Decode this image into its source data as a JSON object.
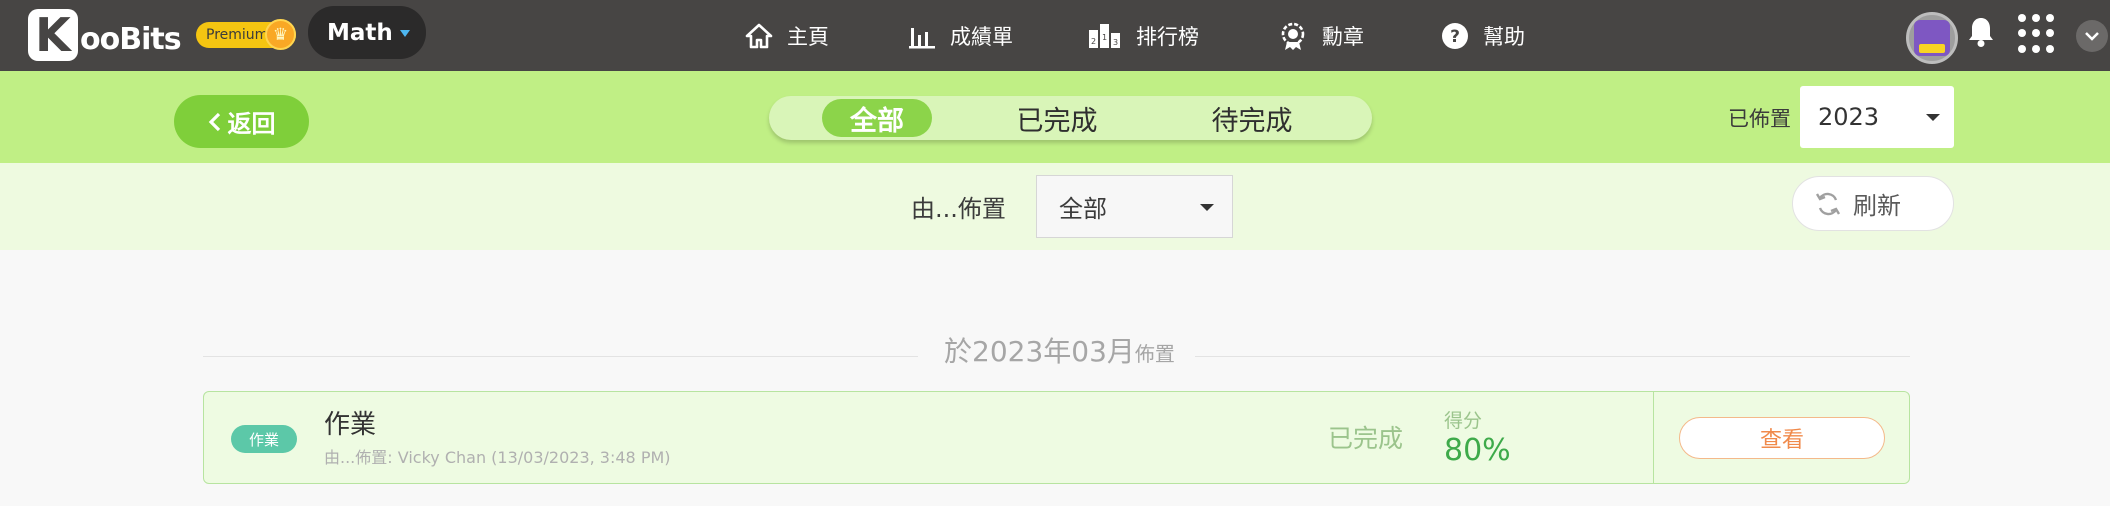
{
  "topbar": {
    "logo_k": "K",
    "logo_text": "ooBits",
    "premium_label": "Premium",
    "subject": "Math",
    "nav": [
      {
        "label": "主頁",
        "icon": "home-icon"
      },
      {
        "label": "成績單",
        "icon": "bar-chart-icon"
      },
      {
        "label": "排行榜",
        "icon": "leaderboard-icon"
      },
      {
        "label": "勳章",
        "icon": "medal-icon"
      },
      {
        "label": "幫助",
        "icon": "help-icon"
      }
    ]
  },
  "filters": {
    "back_label": "返回",
    "segments": [
      "全部",
      "已完成",
      "待完成"
    ],
    "active_segment": "全部",
    "assigned_label": "已佈置",
    "year_value": "2023",
    "assigned_by_label": "由...佈置",
    "assigned_by_value": "全部",
    "refresh_label": "刷新"
  },
  "section": {
    "title_main": "於2023年03月",
    "title_suffix": "佈置"
  },
  "assignments": [
    {
      "tag": "作業",
      "title": "作業",
      "subtitle": "由...佈置: Vicky Chan (13/03/2023, 3:48 PM)",
      "status": "已完成",
      "score_label": "得分",
      "score": "80%",
      "action_label": "查看"
    }
  ],
  "colors": {
    "topbar": "#474544",
    "greenbar": "#c0ef85",
    "accent_green": "#8cd44a",
    "card_bg": "#eefbe2",
    "view_button_text": "#f08a4b"
  }
}
